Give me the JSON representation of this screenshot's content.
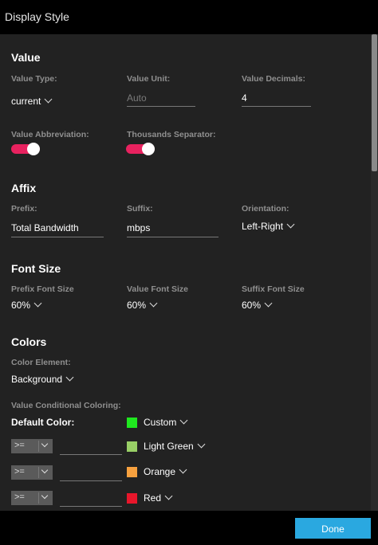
{
  "window": {
    "title": "Display Style"
  },
  "value_section": {
    "heading": "Value",
    "type_label": "Value Type:",
    "type_value": "current",
    "unit_label": "Value Unit:",
    "unit_placeholder": "Auto",
    "decimals_label": "Value Decimals:",
    "decimals_value": "4",
    "abbrev_label": "Value Abbreviation:",
    "abbrev_on": true,
    "thousands_label": "Thousands Separator:",
    "thousands_on": true
  },
  "affix_section": {
    "heading": "Affix",
    "prefix_label": "Prefix:",
    "prefix_value": "Total Bandwidth",
    "suffix_label": "Suffix:",
    "suffix_value": "mbps",
    "orientation_label": "Orientation:",
    "orientation_value": "Left-Right"
  },
  "font_section": {
    "heading": "Font Size",
    "prefix_label": "Prefix Font Size",
    "prefix_value": "60%",
    "value_label": "Value Font Size",
    "value_value": "60%",
    "suffix_label": "Suffix Font Size",
    "suffix_value": "60%"
  },
  "colors_section": {
    "heading": "Colors",
    "element_label": "Color Element:",
    "element_value": "Background",
    "conditional_label": "Value Conditional Coloring:",
    "default_label": "Default Color:",
    "default_color_name": "Custom",
    "default_color_hex": "#1fe81f",
    "rules": [
      {
        "operator": ">=",
        "value": "",
        "color_name": "Light Green",
        "color_hex": "#99cf66"
      },
      {
        "operator": ">=",
        "value": "",
        "color_name": "Orange",
        "color_hex": "#f7a13f"
      },
      {
        "operator": ">=",
        "value": "",
        "color_name": "Red",
        "color_hex": "#e8162b"
      }
    ]
  },
  "footer": {
    "done_label": "Done"
  },
  "theme": {
    "accent": "#e8225f",
    "button": "#2aa8e0"
  }
}
